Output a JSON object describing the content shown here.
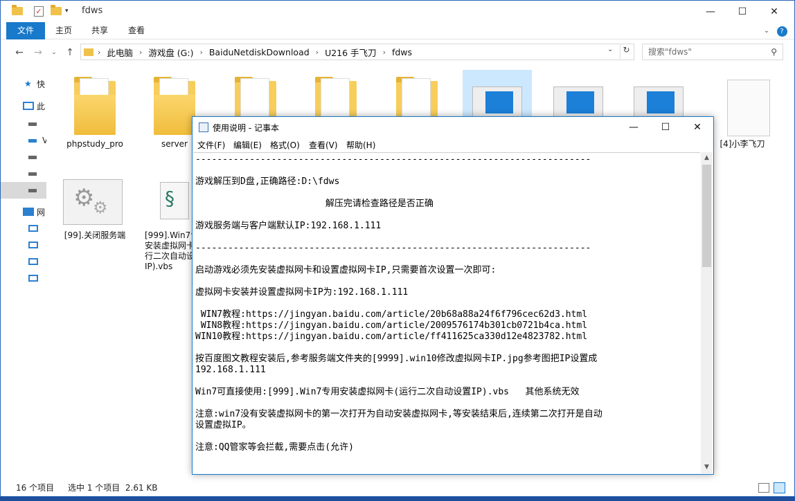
{
  "explorer": {
    "title": "fdws",
    "tabs": [
      "文件",
      "主页",
      "共享",
      "查看"
    ],
    "breadcrumbs": [
      "此电脑",
      "游戏盘 (G:)",
      "BaiduNetdiskDownload",
      "U216 手飞刀",
      "fdws"
    ],
    "search_placeholder": "搜索\"fdws\"",
    "nav_items": [
      "快",
      "此",
      "",
      "V",
      "",
      "",
      "",
      "网",
      "",
      "",
      "",
      ""
    ],
    "items": [
      {
        "label": "phpstudy_pro",
        "kind": "folder"
      },
      {
        "label": "server",
        "kind": "folder"
      },
      {
        "label": "",
        "kind": "folder"
      },
      {
        "label": "",
        "kind": "folder"
      },
      {
        "label": "",
        "kind": "folder"
      },
      {
        "label": "",
        "kind": "image"
      },
      {
        "label": "",
        "kind": "image"
      },
      {
        "label": "",
        "kind": "image"
      },
      {
        "label": "[4]小李飞刀",
        "kind": "file"
      },
      {
        "label": "[99].关闭服务端",
        "kind": "gear"
      },
      {
        "label": "[999].Win7专用安装虚拟网卡(运行二次自动设置IP).vbs",
        "kind": "script",
        "lines": [
          "[999].Win7专",
          "安装虚拟网卡",
          "行二次自动设",
          "IP).vbs"
        ]
      }
    ],
    "status": {
      "count": "16 个项目",
      "selection": "选中 1 个项目  2.61 KB"
    }
  },
  "notepad": {
    "title": "使用说明 - 记事本",
    "menu": [
      "文件(F)",
      "编辑(E)",
      "格式(O)",
      "查看(V)",
      "帮助(H)"
    ],
    "lines": [
      "-------------------------------------------------------------------------",
      "游戏解压到D盘,正确路径:D:\\fdws",
      "                        解压完请检查路径是否正确",
      "游戏服务端与客户端默认IP:192.168.1.111",
      "-------------------------------------------------------------------------",
      "启动游戏必须先安装虚拟网卡和设置虚拟网卡IP,只需要首次设置一次即可:",
      "虚拟网卡安装并设置虚拟网卡IP为:192.168.1.111",
      " WIN7教程:https://jingyan.baidu.com/article/20b68a88a24f6f796cec62d3.html",
      " WIN8教程:https://jingyan.baidu.com/article/2009576174b301cb0721b4ca.html",
      "WIN10教程:https://jingyan.baidu.com/article/ff411625ca330d12e4823782.html",
      "按百度图文教程安装后,参考服务端文件夹的[9999].win10修改虚拟网卡IP.jpg参考图把IP设置成",
      "192.168.1.111",
      "Win7可直接使用:[999].Win7专用安装虚拟网卡(运行二次自动设置IP).vbs   其他系统无效",
      "注意:win7没有安装虚拟网卡的第一次打开为自动安装虚拟网卡,等安装结束后,连续第二次打开是自动",
      "设置虚拟IP。",
      "注意:QQ管家等会拦截,需要点击(允许)"
    ]
  }
}
